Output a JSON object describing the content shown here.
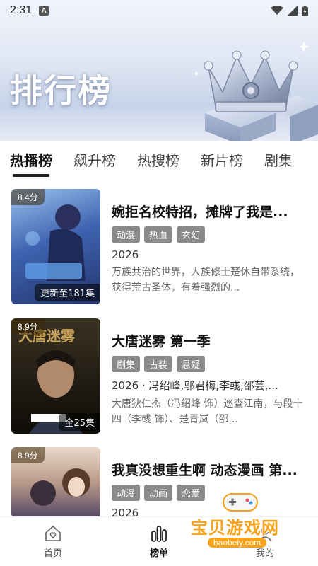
{
  "status_bar": {
    "time": "2:31",
    "notification_letter": "A"
  },
  "banner": {
    "title": "排行榜"
  },
  "tabs": [
    {
      "label": "热播榜",
      "active": true
    },
    {
      "label": "飙升榜",
      "active": false
    },
    {
      "label": "热搜榜",
      "active": false
    },
    {
      "label": "新片榜",
      "active": false
    },
    {
      "label": "剧集",
      "active": false
    }
  ],
  "items": [
    {
      "rating": "8.4分",
      "title": "婉拒名校特招，摊牌了我是...",
      "tags": [
        "动漫",
        "热血",
        "玄幻"
      ],
      "meta": "2026",
      "desc": "万族共治的世界，人族修士楚休自带系统，获得荒古圣体，有着强烈的...",
      "episode_badge": "更新至181集",
      "poster_colors": [
        "#3b5fa8",
        "#8fb6e6"
      ]
    },
    {
      "rating": "8.9分",
      "title": "大唐迷雾 第一季",
      "tags": [
        "剧集",
        "古装",
        "悬疑"
      ],
      "meta": "2026 · 冯绍峰,邬君梅,李彧,邵芸,...",
      "desc": "大唐狄仁杰（冯绍峰 饰）巡查江南，与段十四（李彧 饰）、楚青岚（邵...",
      "episode_badge": "全25集",
      "poster_colors": [
        "#2a2418",
        "#5a4a30"
      ]
    },
    {
      "rating": "8.9分",
      "title": "我真没想重生啊 动态漫画 第...",
      "tags": [
        "动漫",
        "动画",
        "恋爱"
      ],
      "meta": "2026",
      "desc": "",
      "episode_badge": "",
      "poster_colors": [
        "#c9a58a",
        "#4a3e52"
      ]
    }
  ],
  "bottom_nav": [
    {
      "label": "首页",
      "icon": "house-heart-icon",
      "active": false
    },
    {
      "label": "榜单",
      "icon": "bar-chart-icon",
      "active": true
    },
    {
      "label": "我的",
      "icon": "user-icon",
      "active": false
    }
  ],
  "watermark": {
    "text": "宝贝游戏网",
    "url": "baobeiy.com"
  },
  "colors": {
    "tag_bg": "#8a8a8a",
    "watermark": "#f6a21a",
    "active_tab": "#111111"
  }
}
